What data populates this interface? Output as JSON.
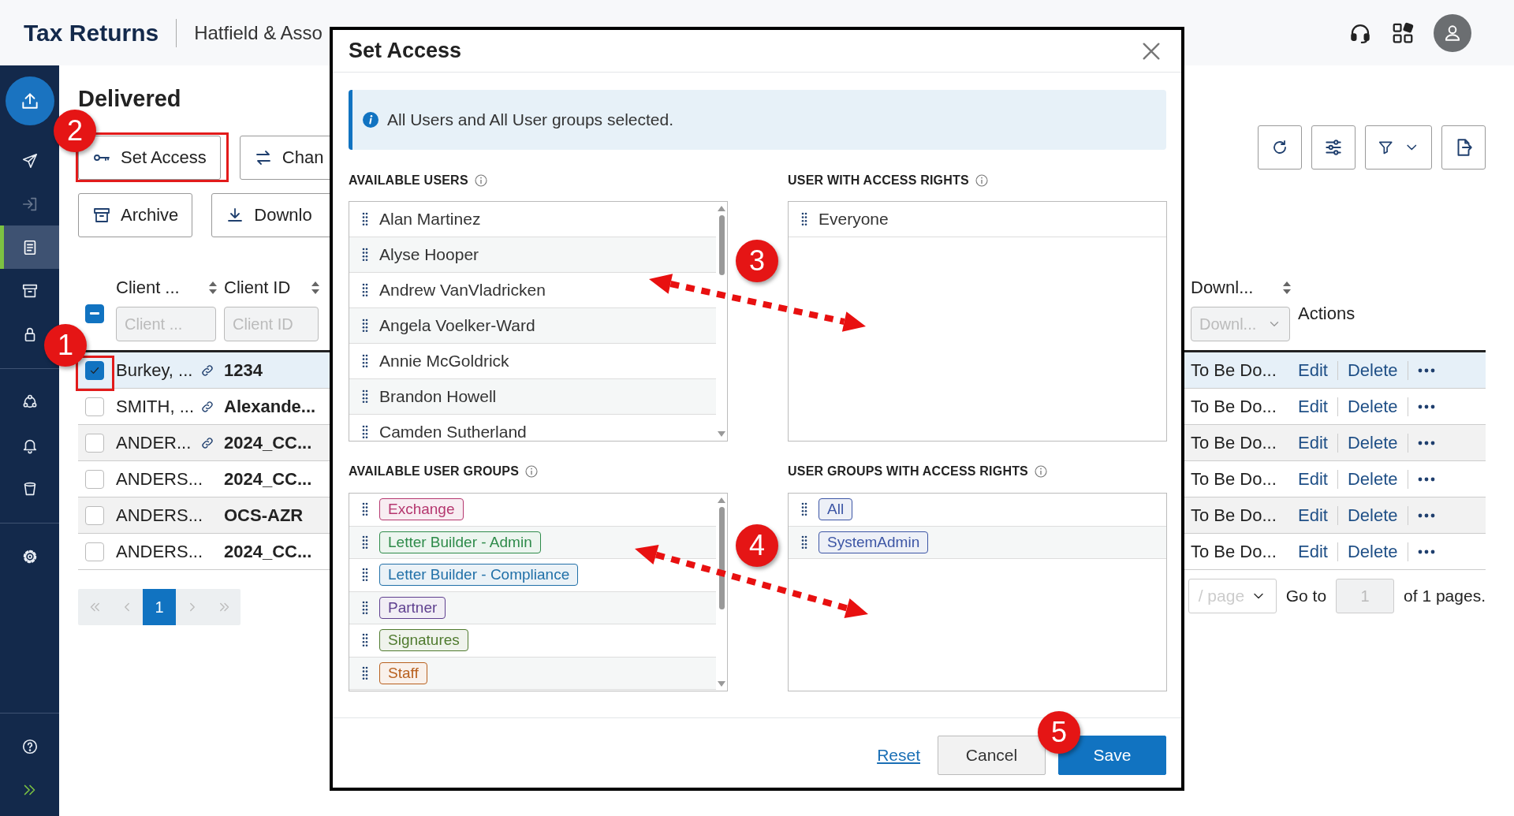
{
  "header": {
    "title": "Tax Returns",
    "breadcrumb": "Hatfield & Asso"
  },
  "sidebar": {
    "items": [
      {
        "selected": false,
        "disabled": false
      },
      {
        "selected": false,
        "disabled": true
      },
      {
        "selected": true,
        "disabled": false
      },
      {
        "selected": false,
        "disabled": false
      },
      {
        "selected": false,
        "disabled": false
      },
      {
        "selected": false,
        "disabled": false
      },
      {
        "selected": false,
        "disabled": false
      },
      {
        "selected": false,
        "disabled": false
      },
      {
        "selected": false,
        "disabled": false
      },
      {
        "selected": false,
        "disabled": false
      },
      {
        "selected": false,
        "disabled": false
      }
    ]
  },
  "page_title": "Delivered",
  "actions": [
    {
      "label": "Set Access"
    },
    {
      "label": "Chan"
    },
    {
      "label": "Archive"
    },
    {
      "label": "Downlo"
    }
  ],
  "table": {
    "select_all": {
      "indeterminate": true
    },
    "columns": [
      {
        "label": "Client ...",
        "sortable": true,
        "filter": {
          "kind": "text",
          "placeholder": "Client ..."
        }
      },
      {
        "label": "Client ID",
        "sortable": true,
        "filter": {
          "kind": "text",
          "placeholder": "Client ID"
        }
      },
      {
        "label": "Downl...",
        "sortable": true,
        "filter": {
          "kind": "select",
          "placeholder": "Downl..."
        }
      },
      {
        "label": "Actions",
        "sortable": false
      }
    ],
    "rows": [
      {
        "checked": true,
        "selected": true,
        "client": "Burkey, ...",
        "linked": true,
        "client_id": "1234",
        "download_status": "To Be Do...",
        "edit": "Edit",
        "delete": "Delete"
      },
      {
        "checked": false,
        "selected": false,
        "client": "SMITH, ...",
        "linked": true,
        "client_id": "Alexande...",
        "download_status": "To Be Do...",
        "edit": "Edit",
        "delete": "Delete"
      },
      {
        "checked": false,
        "selected": false,
        "client": "ANDER...",
        "linked": true,
        "client_id": "2024_CC...",
        "download_status": "To Be Do...",
        "edit": "Edit",
        "delete": "Delete"
      },
      {
        "checked": false,
        "selected": false,
        "client": "ANDERS...",
        "linked": false,
        "client_id": "2024_CC...",
        "download_status": "To Be Do...",
        "edit": "Edit",
        "delete": "Delete"
      },
      {
        "checked": false,
        "selected": false,
        "client": "ANDERS...",
        "linked": false,
        "client_id": "OCS-AZR",
        "download_status": "To Be Do...",
        "edit": "Edit",
        "delete": "Delete"
      },
      {
        "checked": false,
        "selected": false,
        "client": "ANDERS...",
        "linked": false,
        "client_id": "2024_CC...",
        "download_status": "To Be Do...",
        "edit": "Edit",
        "delete": "Delete"
      }
    ]
  },
  "pagination": {
    "pages": [
      {
        "label": "1",
        "selected": true
      }
    ],
    "page_size": "/ page",
    "goto_label": "Go to",
    "goto_placeholder": "1",
    "total": "of 1 pages."
  },
  "dialog": {
    "title": "Set Access",
    "info": "All Users and All User groups selected.",
    "available_users": {
      "label": "AVAILABLE USERS",
      "items": [
        "Alan Martinez",
        "Alyse Hooper",
        "Andrew VanVladricken",
        "Angela Voelker-Ward",
        "Annie McGoldrick",
        "Brandon Howell",
        "Camden Sutherland"
      ]
    },
    "users_with_access": {
      "label": "USER WITH ACCESS RIGHTS",
      "items": [
        "Everyone"
      ]
    },
    "available_groups": {
      "label": "AVAILABLE USER GROUPS",
      "items": [
        {
          "name": "Exchange",
          "color": "#b5376f"
        },
        {
          "name": "Letter Builder - Admin",
          "color": "#2e8b4a"
        },
        {
          "name": "Letter Builder - Compliance",
          "color": "#2170a8"
        },
        {
          "name": "Partner",
          "color": "#5e3f8f"
        },
        {
          "name": "Signatures",
          "color": "#4f7a2e"
        },
        {
          "name": "Staff",
          "color": "#b8601e"
        }
      ]
    },
    "groups_with_access": {
      "label": "USER GROUPS WITH ACCESS RIGHTS",
      "items": [
        {
          "name": "All",
          "color": "#3c55a5"
        },
        {
          "name": "SystemAdmin",
          "color": "#3c55a5"
        }
      ]
    },
    "buttons": [
      {
        "kind": "link",
        "label": "Reset"
      },
      {
        "kind": "secondary",
        "label": "Cancel"
      },
      {
        "kind": "primary",
        "label": "Save"
      }
    ]
  },
  "annotations": [
    {
      "kind": "highlight"
    },
    {
      "kind": "highlight"
    },
    {
      "kind": "marker",
      "label": "1"
    },
    {
      "kind": "marker",
      "label": "2"
    },
    {
      "kind": "marker",
      "label": "3"
    },
    {
      "kind": "marker",
      "label": "4"
    },
    {
      "kind": "marker",
      "label": "5"
    },
    {
      "kind": "arrow"
    },
    {
      "kind": "arrow"
    }
  ]
}
